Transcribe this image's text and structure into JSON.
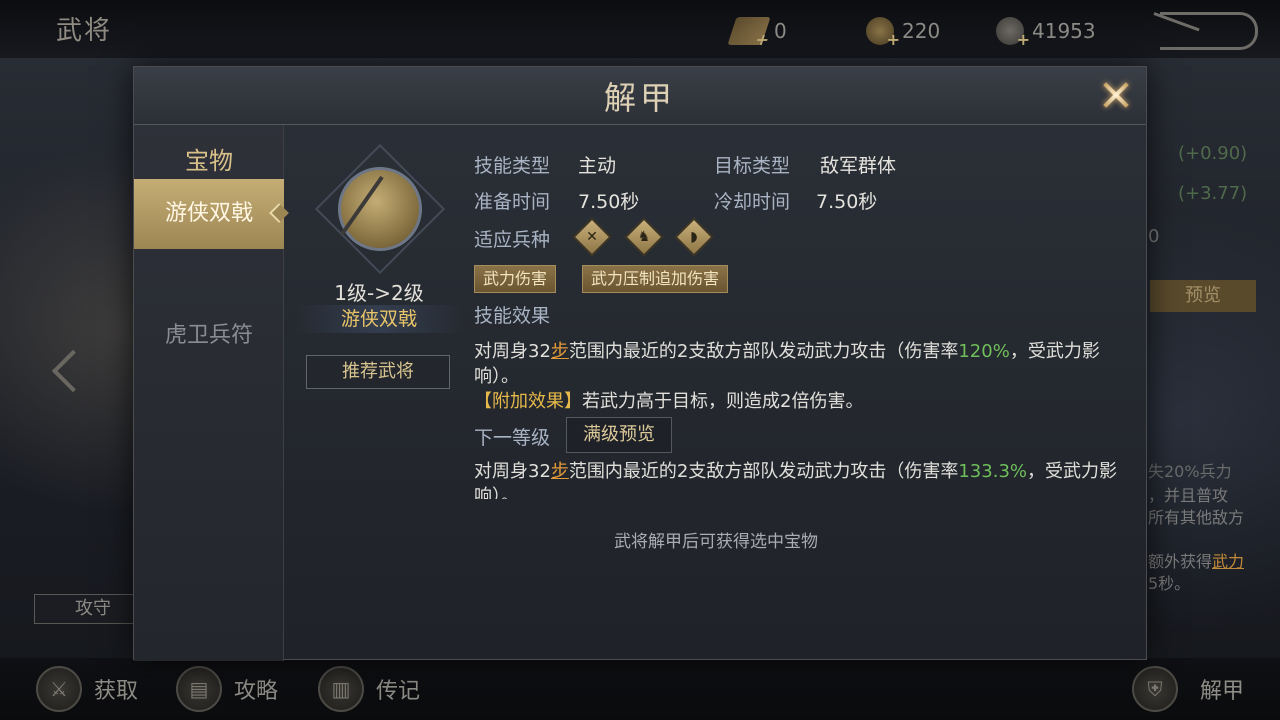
{
  "topbar": {
    "title": "武将",
    "resources": [
      {
        "icon": "scroll-icon",
        "value": "0"
      },
      {
        "icon": "copper-coin-icon",
        "value": "220"
      },
      {
        "icon": "silver-coin-icon",
        "value": "41953"
      }
    ]
  },
  "background": {
    "peek_values": [
      "(+0.90)",
      "(+3.77)",
      "0"
    ],
    "preview_label": "预览",
    "side_text": [
      "失20%兵力",
      "，并且普攻",
      "所有其他敌方",
      "额外获得",
      "武力",
      "5秒。"
    ],
    "gongshou_label": "攻守"
  },
  "modal": {
    "title": "解甲",
    "tab_header": "宝物",
    "tabs": [
      {
        "label": "游侠双戟",
        "active": true
      },
      {
        "label": "虎卫兵符",
        "active": false
      }
    ],
    "treasure": {
      "level": "1级->2级",
      "name": "游侠双戟",
      "recommend_label": "推荐武将"
    },
    "skill": {
      "type_label": "技能类型",
      "type_value": "主动",
      "target_label": "目标类型",
      "target_value": "敌军群体",
      "prep_label": "准备时间",
      "prep_value": "7.50秒",
      "cooldown_label": "冷却时间",
      "cooldown_value": "7.50秒",
      "troops_label": "适应兵种",
      "troop_icons": [
        "crossed-spears-icon",
        "horse-icon",
        "bow-icon"
      ],
      "tags": [
        "武力伤害",
        "武力压制追加伤害"
      ],
      "effect_label": "技能效果",
      "effect_part1": "对周身32",
      "effect_step": "步",
      "effect_part2": "范围内最近的2支敌方部队发动武力攻击（伤害率",
      "effect_rate": "120%",
      "effect_part3": "，受武力影响）。",
      "bonus_label": "【附加效果】",
      "bonus_text": "若武力高于目标，则造成2倍伤害。",
      "next_label": "下一等级",
      "full_preview_label": "满级预览",
      "next_part1": "对周身32",
      "next_step": "步",
      "next_part2": "范围内最近的2支敌方部队发动武力攻击（伤害率",
      "next_rate": "133.3%",
      "next_part3": "，受武力影响）。"
    },
    "footer_note": "武将解甲后可获得选中宝物"
  },
  "bottom_nav": [
    {
      "label": "获取",
      "icon": "crossed-swords-icon"
    },
    {
      "label": "攻略",
      "icon": "scroll-icon"
    },
    {
      "label": "传记",
      "icon": "book-icon"
    },
    {
      "label": "解甲",
      "icon": "armor-icon"
    }
  ],
  "colors": {
    "accent_gold": "#c5ad75",
    "highlight_green": "#6fbf5a",
    "link_orange": "#e29a3a",
    "bonus_gold": "#e6b94a"
  }
}
